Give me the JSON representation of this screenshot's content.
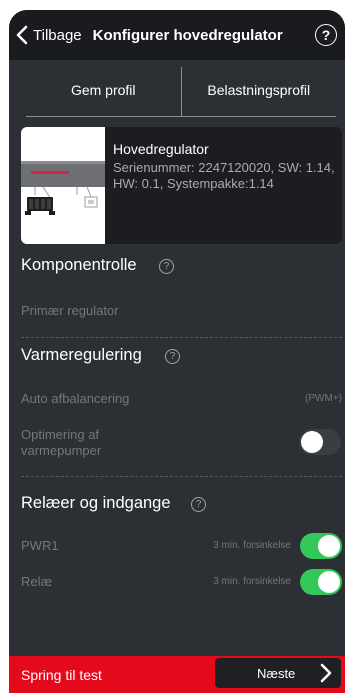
{
  "header": {
    "back_label": "Tilbage",
    "title": "Konfigurer hovedregulator",
    "help_symbol": "?"
  },
  "tabs": [
    {
      "label": "Gem profil"
    },
    {
      "label": "Belastningsprofil"
    }
  ],
  "device": {
    "name": "Hovedregulator",
    "info": "Serienummer: 2247120020, SW: 1.14, HW: 0.1, Systempakke:1.14"
  },
  "sections": {
    "component_role": {
      "title": "Komponentrolle",
      "help_symbol": "?",
      "primary_label": "Primær regulator"
    },
    "heat_regulation": {
      "title": "Varmeregulering",
      "help_symbol": "?",
      "auto_balance_label": "Auto afbalancering",
      "auto_balance_value": "(PWM+)",
      "heatpump_label": "Optimering af varmepumper",
      "heatpump_on": false
    },
    "relays": {
      "title": "Relæer og indgange",
      "help_symbol": "?",
      "items": [
        {
          "label": "PWR1",
          "delay": "3 min. forsinkelse",
          "on": true
        },
        {
          "label": "Relæ",
          "delay": "3 min. forsinkelse",
          "on": true
        }
      ]
    }
  },
  "footer": {
    "skip_label": "Spring til test",
    "next_label": "Næste"
  },
  "colors": {
    "accent_red": "#e5091c",
    "toggle_on": "#34c759",
    "toggle_off": "#3a3d42"
  }
}
